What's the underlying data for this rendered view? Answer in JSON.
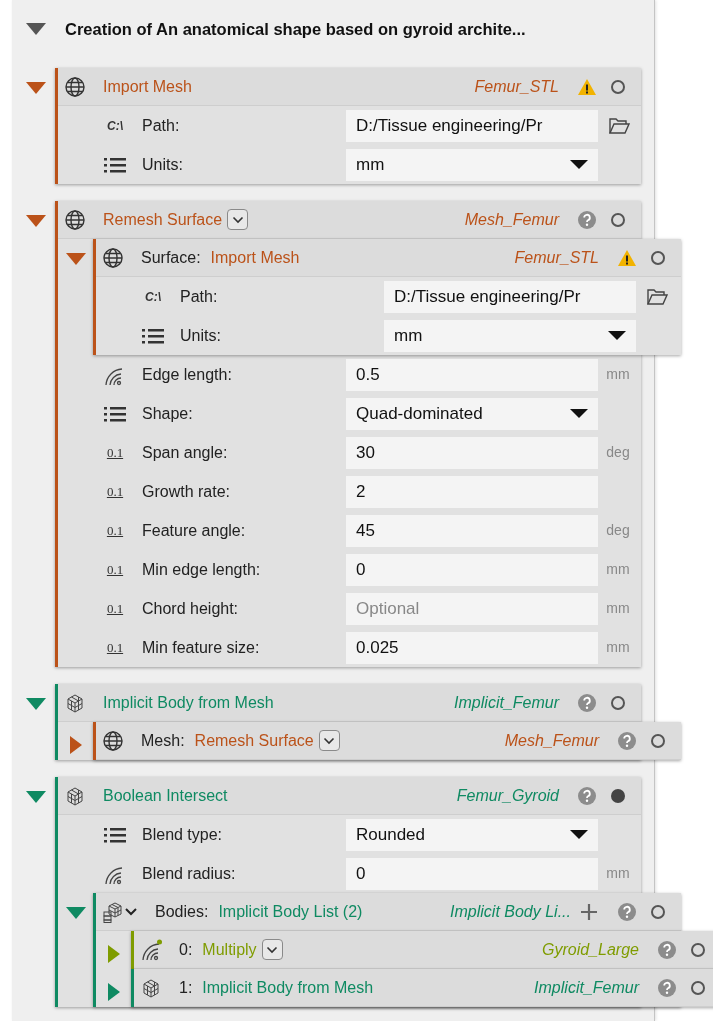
{
  "title": "Creation of An anatomical shape based on gyroid archite...",
  "expanded": true,
  "nodes": [
    {
      "kind": "mesh",
      "color": "#bb5219",
      "expanded": true,
      "name": "Import Mesh",
      "variable": "Femur_STL",
      "warning": true,
      "output_set": false,
      "items": [
        {
          "kind": "path",
          "icon_text": "C:\\",
          "label": "Path:",
          "value": "D:/Tissue engineering/Pr"
        },
        {
          "kind": "choice",
          "label": "Units:",
          "value": "mm"
        }
      ]
    },
    {
      "kind": "mesh",
      "color": "#bb5219",
      "expanded": true,
      "name": "Remesh Surface",
      "dropdown": true,
      "variable": "Mesh_Femur",
      "warning": false,
      "output_set": false,
      "items": [
        {
          "kind": "mesh",
          "color": "#bb5219",
          "expanded": true,
          "prefix": "Surface:",
          "name": "Import Mesh",
          "variable": "Femur_STL",
          "warning": true,
          "output_set": false,
          "items": [
            {
              "kind": "path",
              "icon_text": "C:\\",
              "label": "Path:",
              "value": "D:/Tissue engineering/Pr"
            },
            {
              "kind": "choice",
              "label": "Units:",
              "value": "mm"
            }
          ]
        },
        {
          "kind": "scalar",
          "label": "Edge length:",
          "value": "0.5",
          "unit": "mm"
        },
        {
          "kind": "choice",
          "label": "Shape:",
          "value": "Quad-dominated"
        },
        {
          "kind": "number",
          "icon_text": "0.1",
          "label": "Span angle:",
          "value": "30",
          "unit": "deg"
        },
        {
          "kind": "number",
          "icon_text": "0.1",
          "label": "Growth rate:",
          "value": "2"
        },
        {
          "kind": "number",
          "icon_text": "0.1",
          "label": "Feature angle:",
          "value": "45",
          "unit": "deg"
        },
        {
          "kind": "number",
          "icon_text": "0.1",
          "label": "Min edge length:",
          "value": "0",
          "unit": "mm"
        },
        {
          "kind": "number",
          "icon_text": "0.1",
          "label": "Chord height:",
          "placeholder": "Optional",
          "unit": "mm"
        },
        {
          "kind": "number",
          "icon_text": "0.1",
          "label": "Min feature size:",
          "value": "0.025",
          "unit": "mm"
        }
      ]
    },
    {
      "kind": "implicit",
      "color": "#0f8a62",
      "expanded": true,
      "name": "Implicit Body from Mesh",
      "variable": "Implicit_Femur",
      "warning": false,
      "output_set": false,
      "items": [
        {
          "kind": "mesh",
          "color": "#bb5219",
          "expanded": false,
          "prefix": "Mesh:",
          "name": "Remesh Surface",
          "dropdown": true,
          "variable": "Mesh_Femur",
          "warning": false,
          "output_set": false
        }
      ]
    },
    {
      "kind": "implicit",
      "color": "#0f8a62",
      "expanded": true,
      "name": "Boolean Intersect",
      "variable": "Femur_Gyroid",
      "warning": false,
      "output_set": true,
      "items": [
        {
          "kind": "choice",
          "label": "Blend type:",
          "value": "Rounded"
        },
        {
          "kind": "scalar",
          "label": "Blend radius:",
          "value": "0",
          "unit": "mm"
        },
        {
          "kind": "list",
          "color": "#0f8a62",
          "expanded": true,
          "prefix": "Bodies:",
          "name": "Implicit Body List (2)",
          "variable": "Implicit Body Li...",
          "can_add": true,
          "warning": false,
          "output_set": false,
          "items": [
            {
              "kind": "field",
              "color": "#7f9c00",
              "expanded": false,
              "prefix": "0:",
              "name": "Multiply",
              "dropdown": true,
              "variable": "Gyroid_Large",
              "warning": false,
              "output_set": false
            },
            {
              "kind": "implicit",
              "color": "#0f8a62",
              "expanded": false,
              "prefix": "1:",
              "name": "Implicit Body from Mesh",
              "variable": "Implicit_Femur",
              "warning": false,
              "output_set": false
            }
          ]
        }
      ]
    }
  ]
}
